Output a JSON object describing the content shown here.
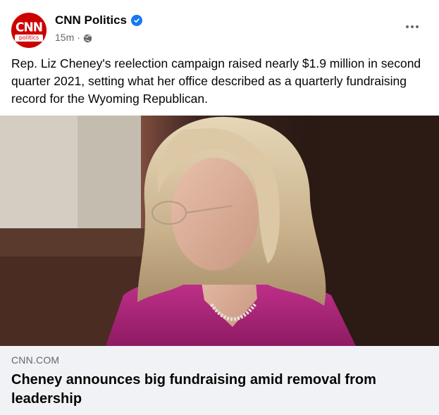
{
  "post": {
    "page_name": "CNN Politics",
    "avatar": {
      "logo_text": "CNN",
      "logo_subtitle": "politics"
    },
    "timestamp": "15m",
    "separator": "·",
    "privacy_icon": "globe-icon",
    "verified_icon": "verified-badge-icon",
    "more_icon": "more-options-icon",
    "caption": "Rep. Liz Cheney's reelection campaign raised nearly $1.9 million in second quarter 2021, setting what her office described as a quarterly fundraising record for the Wyoming Republican."
  },
  "link_preview": {
    "domain": "CNN.COM",
    "headline": "Cheney announces big fundraising amid removal from leadership"
  },
  "colors": {
    "brand_red": "#cc0000",
    "verified_blue": "#1877f2",
    "secondary_text": "#65676b",
    "link_box_bg": "#f0f2f5"
  }
}
